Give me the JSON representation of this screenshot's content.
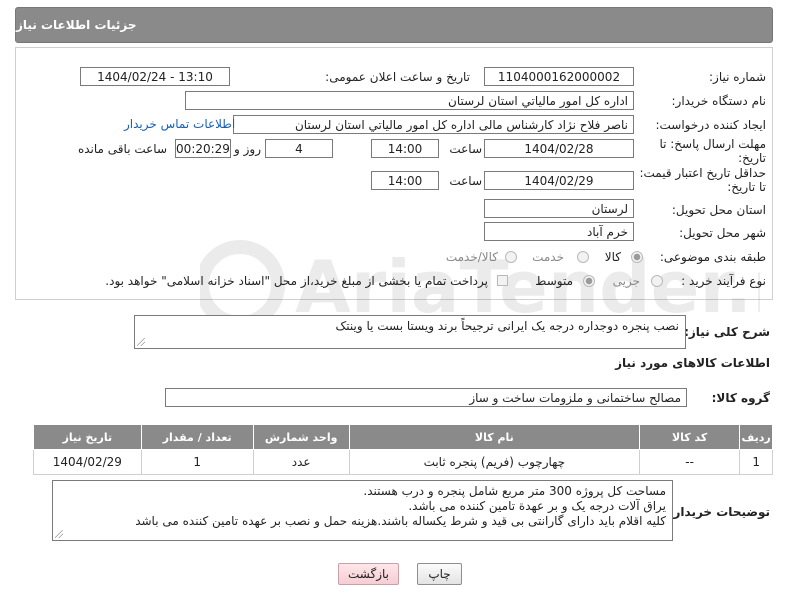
{
  "header": {
    "title": "جزئیات اطلاعات نیاز"
  },
  "form": {
    "need_number": {
      "label": "شماره نیاز:",
      "value": "1104000162000002"
    },
    "announce": {
      "label": "تاریخ و ساعت اعلان عمومی:",
      "value": "1404/02/24 - 13:10"
    },
    "buyer_org": {
      "label": "نام دستگاه خریدار:",
      "value": "اداره کل امور مالياتي استان لرستان"
    },
    "requester": {
      "label": "ایجاد کننده درخواست:",
      "value": "ناصر فلاح نژاد کارشناس مالی اداره کل امور مالياتي استان لرستان",
      "contact_link": "اطلاعات تماس خریدار"
    },
    "reply_deadline": {
      "label_line1": "مهلت ارسال پاسخ: تا",
      "label_line2": "تاریخ:",
      "date": "1404/02/28",
      "time_label": "ساعت",
      "time": "14:00",
      "days": "4",
      "days_label": "روز و",
      "remaining": "00:20:29",
      "remaining_label": "ساعت باقی مانده"
    },
    "price_validity": {
      "label_line1": "حداقل تاریخ اعتبار قیمت:",
      "label_line2": "تا تاریخ:",
      "date": "1404/02/29",
      "time_label": "ساعت",
      "time": "14:00"
    },
    "delivery_province": {
      "label": "استان محل تحویل:",
      "value": "لرستان"
    },
    "delivery_city": {
      "label": "شهر محل تحویل:",
      "value": "خرم آباد"
    },
    "category": {
      "label": "طبقه بندی موضوعی:",
      "options": [
        "کالا",
        "خدمت",
        "کالا/خدمت"
      ],
      "selected": "کالا"
    },
    "process": {
      "label": "نوع فرآیند خرید :",
      "options": [
        "جزیی",
        "متوسط"
      ],
      "selected": "متوسط",
      "checkbox_text": "پرداخت تمام یا بخشی از مبلغ خرید،از محل \"اسناد خزانه اسلامی\" خواهد بود."
    }
  },
  "description": {
    "label": "شرح کلی نیاز:",
    "value": "نصب پنجره دوجداره درجه یک ایرانی ترجیحاً برند ویستا بست یا وینتک"
  },
  "goods_section": {
    "title": "اطلاعات کالاهای مورد نیاز"
  },
  "goods_group": {
    "label": "گروه کالا:",
    "value": "مصالح ساختمانی و ملزومات ساخت و ساز"
  },
  "table": {
    "headers": [
      "ردیف",
      "کد کالا",
      "نام کالا",
      "واحد شمارش",
      "تعداد / مقدار",
      "تاریخ نیاز"
    ],
    "rows": [
      [
        "1",
        "--",
        "چهارچوب (فریم) پنجره ثابت",
        "عدد",
        "1",
        "1404/02/29"
      ]
    ]
  },
  "buyer_notes": {
    "label": "توضیحات خریدار:",
    "lines": [
      "مساحت کل پروژه 300 متر مربع شامل پنجره و درب هستند.",
      "یراق آلات درجه یک و بر عهدة تامین کننده می باشد.",
      "کلیه اقلام باید دارای گارانتی بی قید و شرط یکساله باشند.هزینه حمل و نصب بر عهده تامین کننده می باشد"
    ]
  },
  "buttons": {
    "print": "چاپ",
    "back": "بازگشت"
  },
  "watermark": {
    "text": "AriaTender.net"
  }
}
